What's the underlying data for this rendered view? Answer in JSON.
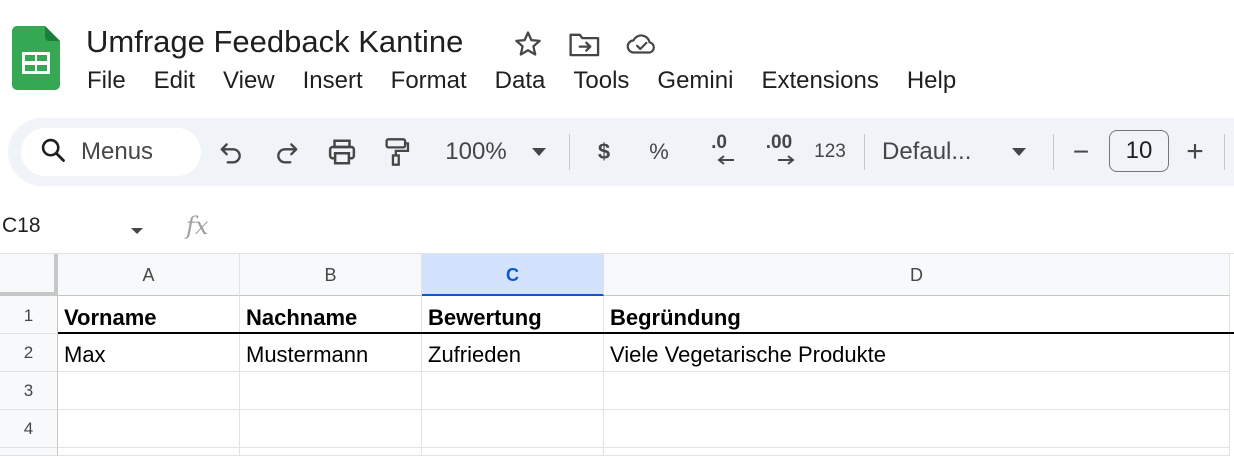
{
  "document": {
    "title": "Umfrage Feedback Kantine"
  },
  "title_icons": [
    "star-icon",
    "move-to-folder-icon",
    "cloud-saved-icon"
  ],
  "menu": [
    "File",
    "Edit",
    "View",
    "Insert",
    "Format",
    "Data",
    "Tools",
    "Gemini",
    "Extensions",
    "Help"
  ],
  "toolbar": {
    "search_label": "Menus",
    "zoom": "100%",
    "currency": "$",
    "percent": "%",
    "decrease_decimal": ".0",
    "increase_decimal": ".00",
    "more_formats": "123",
    "font": "Defaul...",
    "font_size": "10",
    "minus": "−",
    "plus": "+"
  },
  "formula_bar": {
    "cell_ref": "C18",
    "fx": "fx",
    "content": ""
  },
  "grid": {
    "columns": [
      "A",
      "B",
      "C",
      "D"
    ],
    "selected_column": "C",
    "row_numbers": [
      "1",
      "2",
      "3",
      "4"
    ],
    "rows": [
      [
        "Vorname",
        "Nachname",
        "Bewertung",
        "Begründung"
      ],
      [
        "Max",
        "Mustermann",
        "Zufrieden",
        "Viele Vegetarische Produkte"
      ],
      [
        "",
        "",
        "",
        ""
      ],
      [
        "",
        "",
        "",
        ""
      ]
    ]
  },
  "colors": {
    "sheets_green": "#34a853",
    "toolbar_bg": "#f0f4f9",
    "selected_header": "#d3e3fd",
    "selected_text": "#0b57d0"
  }
}
